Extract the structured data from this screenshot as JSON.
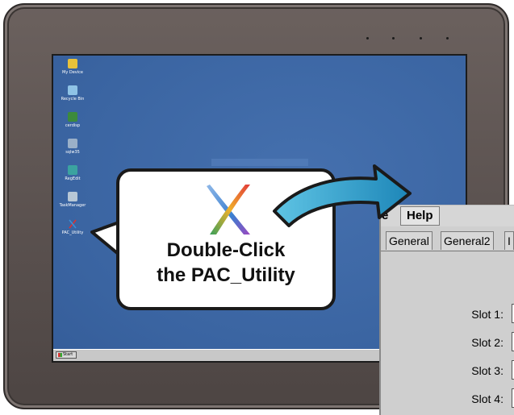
{
  "desktop": {
    "icons": [
      {
        "label": "My Device",
        "icon": "my-device-icon",
        "color": "#e8c23a"
      },
      {
        "label": "Recycle Bin",
        "icon": "recycle-bin-icon",
        "color": "#8fc3e6"
      },
      {
        "label": "cerdisp",
        "icon": "cerdisp-icon",
        "color": "#3c8a3c"
      },
      {
        "label": "sqlw35",
        "icon": "sqlw35-icon",
        "color": "#9ab0c8"
      },
      {
        "label": "RegEdit",
        "icon": "regedit-icon",
        "color": "#3ba3a0"
      },
      {
        "label": "TaskManager",
        "icon": "task-manager-icon",
        "color": "#b7c7d6"
      },
      {
        "label": "PAC_Utility",
        "icon": "pac-utility-icon",
        "color": "#d8d8d8"
      }
    ],
    "taskbar": {
      "start_label": "Start"
    }
  },
  "callout": {
    "line1": "Double-Click",
    "line2": "the PAC_Utility"
  },
  "dialog": {
    "menu": {
      "file_partial": "e",
      "help": "Help"
    },
    "tabs": [
      "General",
      "General2",
      "I"
    ],
    "slots": [
      "Slot 1:",
      "Slot 2:",
      "Slot 3:",
      "Slot 4:"
    ]
  },
  "colors": {
    "bezel": "#5a514f",
    "screen": "#3f6aa8",
    "arrow": "#2aa3c8",
    "callout_border": "#1a1a1a"
  }
}
